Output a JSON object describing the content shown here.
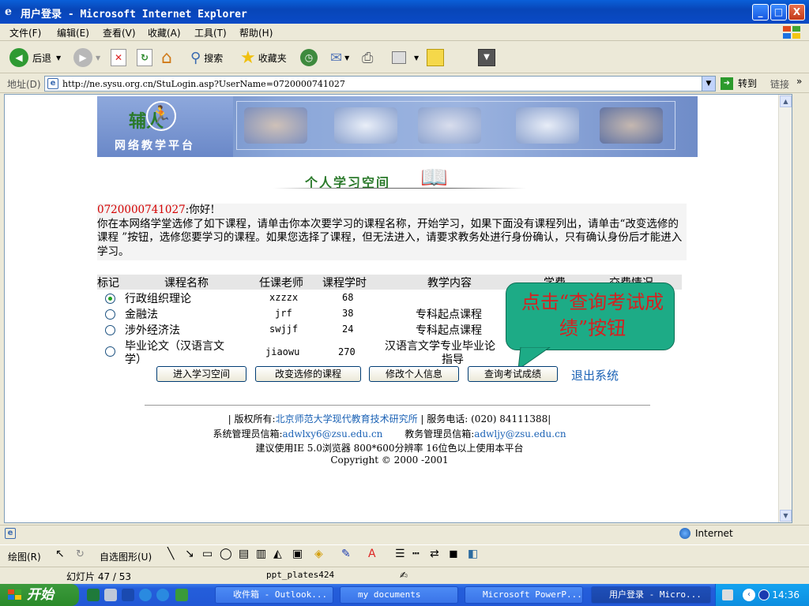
{
  "window": {
    "title": "用户登录 - Microsoft Internet Explorer",
    "min_glyph": "_",
    "max_glyph": "□",
    "close_glyph": "X"
  },
  "menu": [
    "文件(F)",
    "编辑(E)",
    "查看(V)",
    "收藏(A)",
    "工具(T)",
    "帮助(H)"
  ],
  "toolbar": {
    "back": "后退",
    "search": "搜索",
    "favorites": "收藏夹"
  },
  "address": {
    "label": "地址(D)",
    "url": "http://ne.sysu.org.cn/StuLogin.asp?UserName=0720000741027",
    "go": "转到",
    "links": "链接"
  },
  "banner": {
    "logo_text": "辅人",
    "logo_sub": "网络教学平台"
  },
  "page": {
    "space_title": "个人学习空间",
    "user_id": "0720000741027",
    "greeting": ":你好!",
    "intro": "你在本网络学堂选修了如下课程，请单击你本次要学习的课程名称，开始学习，如果下面没有课程列出，请单击“改变选修的课程 ”按钮，选修您要学习的课程。如果您选择了课程，但无法进入，请要求教务处进行身份确认，只有确认身份后才能进入学习。"
  },
  "table": {
    "headers": [
      "标记",
      "课程名称",
      "任课老师",
      "课程学时",
      "教学内容",
      "学费",
      "交费情况"
    ],
    "rows": [
      {
        "name": "行政组织理论",
        "teacher": "xzzzx",
        "hours": "68",
        "content": "",
        "selected": true
      },
      {
        "name": "金融法",
        "teacher": "jrf",
        "hours": "38",
        "content": "专科起点课程",
        "selected": false
      },
      {
        "name": "涉外经济法",
        "teacher": "swjjf",
        "hours": "24",
        "content": "专科起点课程",
        "selected": false
      },
      {
        "name": "毕业论文（汉语言文学）",
        "name_line1": "毕业论文（汉语言文",
        "name_line2": "学）",
        "teacher": "jiaowu",
        "hours": "270",
        "content": "汉语言文学专业毕业论",
        "content_line2": "指导",
        "selected": false
      }
    ]
  },
  "buttons": {
    "enter": "进入学习空间",
    "change": "改变选修的课程",
    "modify": "修改个人信息",
    "scores": "查询考试成绩",
    "logout": "退出系统"
  },
  "callout": {
    "text": "点击“查询考试成绩”按钮"
  },
  "footer": {
    "line1_pre": "| 版权所有:",
    "line1_org": "北京师范大学现代教育技术研究所",
    "line1_post": " | 服务电话: (020) 84111388|",
    "sysadmin_label": "系统管理员信箱:",
    "sysadmin_email": "adwlxy6@zsu.edu.cn",
    "eduadmin_label": "教务管理员信箱:",
    "eduadmin_email": "adwljy@zsu.edu.cn",
    "line3": "建议使用IE 5.0浏览器 800*600分辨率 16位色以上使用本平台",
    "line4": "Copyright © 2000 -2001"
  },
  "statusbar": {
    "zone": "Internet"
  },
  "drawbar": {
    "draw": "绘图(R)",
    "autoshape": "自选图形(U)"
  },
  "pptstatus": {
    "slide": "幻灯片 47 / 53",
    "template": "ppt_plates424"
  },
  "taskbar": {
    "start": "开始",
    "tasks": [
      "收件箱 - Outlook...",
      "my documents",
      "Microsoft PowerP...",
      "用户登录 - Micro..."
    ],
    "clock": "14:36"
  },
  "colors": {
    "accent": "#0a4ac6",
    "callout": "#1dab86",
    "callout_text": "#d62020",
    "user_id": "#d40000",
    "link": "#1b62b5"
  }
}
